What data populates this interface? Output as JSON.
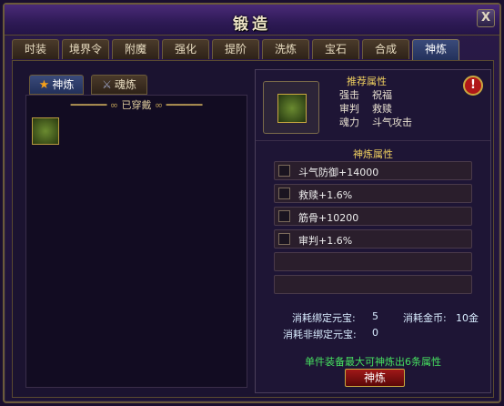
{
  "window": {
    "title": "锻造",
    "close_label": "X"
  },
  "tabs": [
    {
      "label": "时装"
    },
    {
      "label": "境界令"
    },
    {
      "label": "附魔"
    },
    {
      "label": "强化"
    },
    {
      "label": "提阶"
    },
    {
      "label": "洗炼"
    },
    {
      "label": "宝石"
    },
    {
      "label": "合成"
    },
    {
      "label": "神炼",
      "active": true
    }
  ],
  "subtabs": [
    {
      "label": "神炼"
    },
    {
      "label": "魂炼"
    }
  ],
  "equipped": {
    "header": "已穿戴"
  },
  "recommend": {
    "title": "推荐属性",
    "attrs": [
      "强击",
      "祝福",
      "审判",
      "救赎",
      "魂力",
      "斗气攻击"
    ]
  },
  "refine": {
    "title": "神炼属性",
    "rows": [
      "斗气防御+14000",
      "救赎+1.6%",
      "筋骨+10200",
      "审判+1.6%",
      "",
      ""
    ]
  },
  "cost": {
    "bound_label": "消耗绑定元宝:",
    "bound_value": "5",
    "gold_label": "消耗金币:",
    "gold_value": "10金",
    "unbound_label": "消耗非绑定元宝:",
    "unbound_value": "0"
  },
  "hint": "单件装备最大可神炼出6条属性",
  "button": "神炼"
}
